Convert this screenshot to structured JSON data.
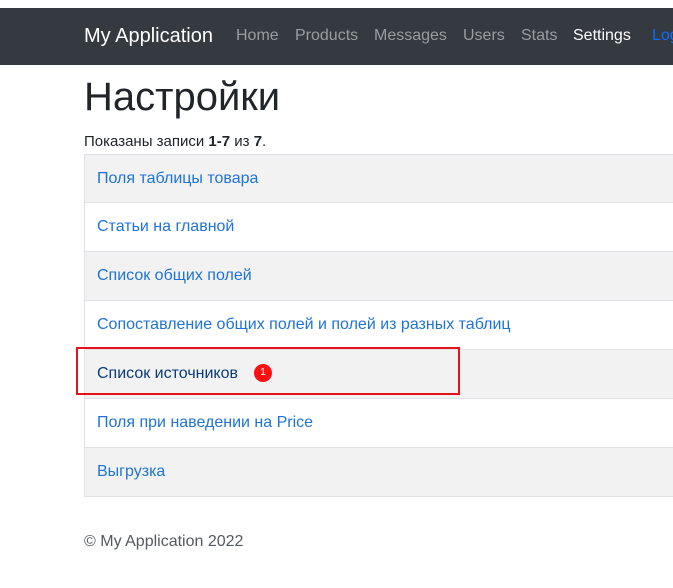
{
  "navbar": {
    "brand": "My Application",
    "items": [
      {
        "label": "Home"
      },
      {
        "label": "Products"
      },
      {
        "label": "Messages"
      },
      {
        "label": "Users"
      },
      {
        "label": "Stats"
      },
      {
        "label": "Settings"
      },
      {
        "label": "Log"
      }
    ]
  },
  "page": {
    "title": "Настройки",
    "summary": {
      "prefix": "Показаны записи ",
      "range": "1-7",
      "mid": " из ",
      "total": "7",
      "suffix": "."
    },
    "items": [
      {
        "label": "Поля таблицы товара"
      },
      {
        "label": "Статьи на главной"
      },
      {
        "label": "Список общих полей"
      },
      {
        "label": "Сопоставление общих полей и полей из разных таблиц"
      },
      {
        "label": "Список источников"
      },
      {
        "label": "Поля при наведении на Price"
      },
      {
        "label": "Выгрузка"
      }
    ],
    "annotation_badge": "1"
  },
  "footer": {
    "text": "© My Application 2022"
  },
  "colors": {
    "navbar_bg": "#343a40",
    "link": "#1e73d6",
    "highlight_border": "#e4141b",
    "badge": "#ff1010"
  }
}
